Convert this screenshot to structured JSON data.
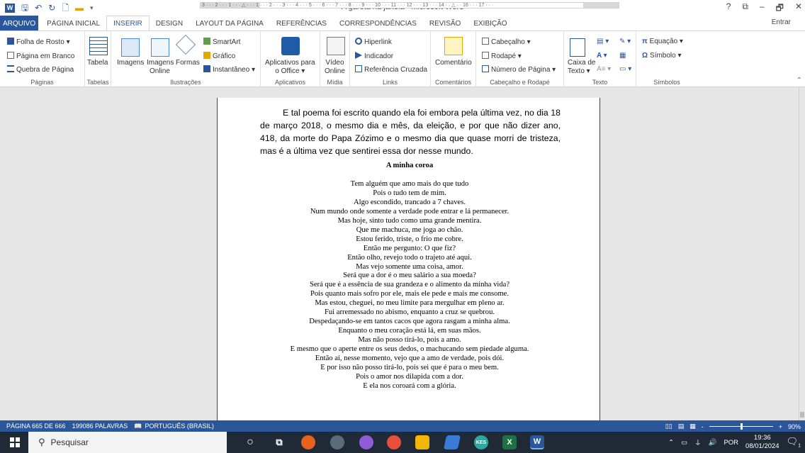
{
  "titlebar": {
    "title": "A garota na janela - Microsoft Word",
    "help": "?",
    "restore": "⧉",
    "minimize": "–",
    "maximize": "🗗",
    "close": "✕"
  },
  "tabs": {
    "file": "ARQUIVO",
    "items": [
      "PÁGINA INICIAL",
      "INSERIR",
      "DESIGN",
      "LAYOUT DA PÁGINA",
      "REFERÊNCIAS",
      "CORRESPONDÊNCIAS",
      "REVISÃO",
      "EXIBIÇÃO"
    ],
    "signin": "Entrar"
  },
  "ribbon": {
    "paginas": {
      "label": "Páginas",
      "cover": "Folha de Rosto ▾",
      "blank": "Página em Branco",
      "break": "Quebra de Página"
    },
    "tabelas": {
      "label": "Tabelas",
      "table": "Tabela"
    },
    "ilustracoes": {
      "label": "Ilustrações",
      "images": "Imagens",
      "online1": "Imagens",
      "online2": "Online",
      "shapes": "Formas",
      "smartart": "SmartArt",
      "chart": "Gráfico",
      "screenshot": "Instantâneo ▾"
    },
    "aplicativos": {
      "label": "Aplicativos",
      "apps1": "Aplicativos para",
      "apps2": "o Office ▾"
    },
    "midia": {
      "label": "Mídia",
      "video1": "Vídeo",
      "video2": "Online"
    },
    "links": {
      "label": "Links",
      "hyperlink": "Hiperlink",
      "bookmark": "Indicador",
      "crossref": "Referência Cruzada"
    },
    "comentarios": {
      "label": "Comentários",
      "comment": "Comentário"
    },
    "cabecalho": {
      "label": "Cabeçalho e Rodapé",
      "header": "Cabeçalho ▾",
      "footer": "Rodapé ▾",
      "pagenum": "Número de Página ▾"
    },
    "texto": {
      "label": "Texto",
      "textbox1": "Caixa de",
      "textbox2": "Texto ▾"
    },
    "simbolos": {
      "label": "Símbolos",
      "equation": "Equação ▾",
      "symbol": "Símbolo ▾"
    }
  },
  "ruler": {
    "ticks": "3 · · · 2 · · · 1 · · · △ · · · 1 · · · 2 · · · 3 · · · 4 · · · 5 · · · 6 · · · 7 · · · 8 · · · 9 · · · 10 · · · 11 · · · 12 · · · 13 · · · 14 · · △ · · 16 · · · 17 · · ·",
    "tab_selector": "L"
  },
  "document": {
    "prose": "E tal poema foi escrito quando ela foi embora pela última vez, no dia 18 de março 2018, o mesmo dia e mês, da eleição, e por que não dizer ano, 418, da morte do Papa Zózimo e o mesmo dia que quase morri de tristeza, mas é a última vez que sentirei essa dor nesse mundo.",
    "poem_title": "A minha coroa",
    "poem_lines": [
      "Tem alguém que amo mais do que tudo",
      "Pois o tudo tem de mim.",
      "Algo escondido, trancado a 7 chaves.",
      "Num mundo onde somente a verdade pode entrar e lá permanecer.",
      "Mas hoje, sinto tudo como uma grande mentira.",
      "Que me machuca, me joga ao chão.",
      "Estou ferido, triste, o frio me cobre.",
      "Então me pergunto: O que fiz?",
      "Então olho, revejo todo o trajeto até aqui.",
      "Mas vejo somente uma coisa, amor.",
      "Será que a dor é o meu salário a sua moeda?",
      "Será que é a essência de sua grandeza e o alimento da minha vida?",
      "Pois quanto mais sofro por ele, mais ele pede e mais me consome.",
      "Mas estou, cheguei, no meu limite para mergulhar em pleno ar.",
      "Fui arremessado no abismo, enquanto a cruz se quebrou.",
      "Despedaçando-se em tantos cacos que agora rasgam a minha alma.",
      "Enquanto o meu coração está lá, em suas mãos.",
      "Mas não posso tirá-lo, pois a amo.",
      "E mesmo que o aperte entre os seus dedos, o machucando sem piedade alguma.",
      "Então aí, nesse momento, vejo que a amo de verdade, pois dói.",
      "E por isso não posso tirá-lo, pois sei que é para o meu bem.",
      "Pois o amor nos dilapida com a dor.",
      "E ela nos coroará com a glória."
    ]
  },
  "status": {
    "page": "PÁGINA 665 DE 666",
    "words": "199086 PALAVRAS",
    "lang": "PORTUGUÊS (BRASIL)",
    "zoom": "90%",
    "zoom_minus": "-",
    "zoom_plus": "+"
  },
  "taskbar": {
    "search": "Pesquisar",
    "lang": "POR",
    "time": "19:36",
    "date": "08/01/2024",
    "notification_count": "1"
  },
  "colors": {
    "accent": "#2b579a",
    "taskbar": "#1f2a36"
  }
}
